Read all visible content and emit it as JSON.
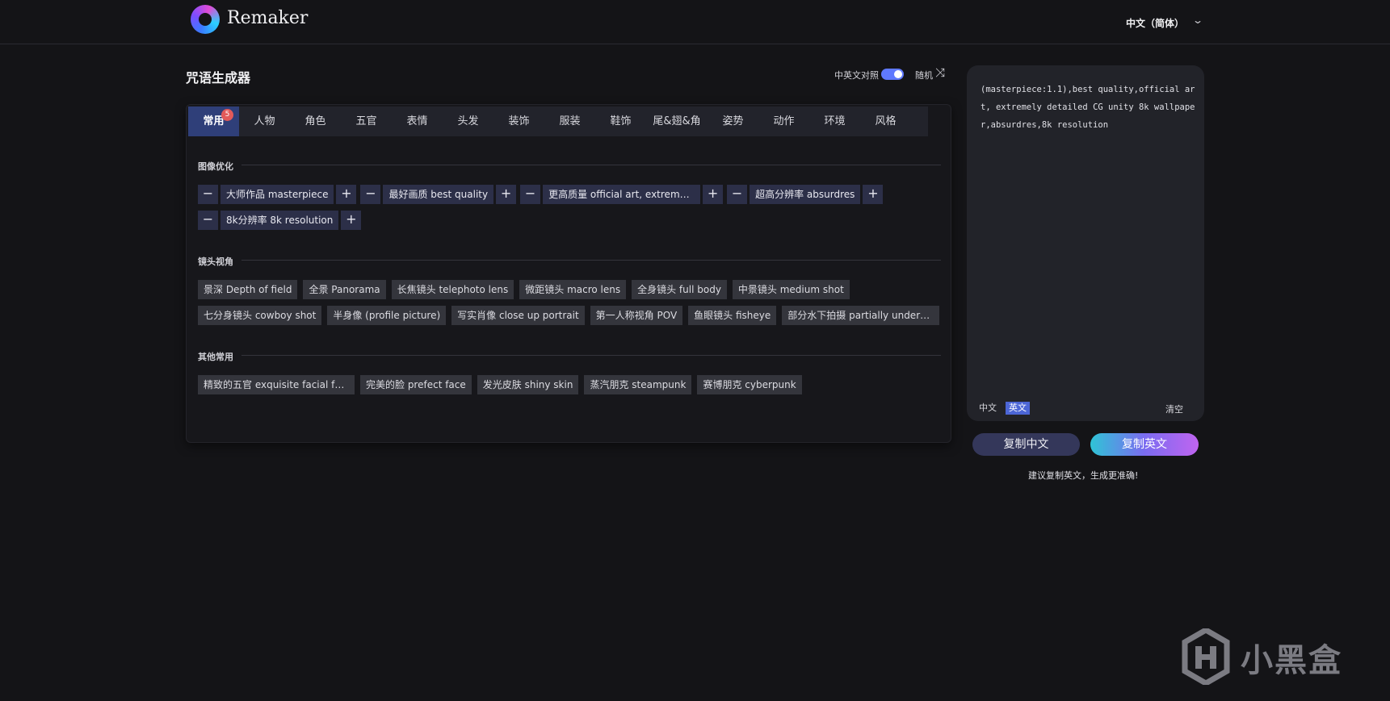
{
  "header": {
    "brand": "Remaker",
    "language": "中文（简体）"
  },
  "toolbar": {
    "title": "咒语生成器",
    "bilingual_label": "中英文对照",
    "bilingual_on": true,
    "random_label": "随机"
  },
  "tabs": [
    {
      "label": "常用",
      "badge": "5",
      "active": true
    },
    {
      "label": "人物"
    },
    {
      "label": "角色"
    },
    {
      "label": "五官"
    },
    {
      "label": "表情"
    },
    {
      "label": "头发"
    },
    {
      "label": "装饰"
    },
    {
      "label": "服装"
    },
    {
      "label": "鞋饰"
    },
    {
      "label": "尾&翅&角"
    },
    {
      "label": "姿势"
    },
    {
      "label": "动作"
    },
    {
      "label": "环境"
    },
    {
      "label": "风格"
    }
  ],
  "sections": {
    "image_opt": {
      "title": "图像优化",
      "selected": [
        "大师作品 masterpiece",
        "最好画质 best quality",
        "更高质量 official art, extremel…",
        "超高分辨率 absurdres",
        "8k分辨率 8k resolution"
      ]
    },
    "lens": {
      "title": "镜头视角",
      "row1": [
        "景深 Depth of field",
        "全景 Panorama",
        "长焦镜头 telephoto lens",
        "微距镜头 macro lens",
        "全身镜头 full body",
        "中景镜头 medium shot"
      ],
      "row2": [
        "七分身镜头 cowboy shot",
        "半身像 (profile picture)",
        "写实肖像 close up portrait",
        "第一人称视角 POV",
        "鱼眼镜头 fisheye",
        "部分水下拍摄 partially underw…"
      ]
    },
    "other": {
      "title": "其他常用",
      "row1": [
        "精致的五官 exquisite facial fe…",
        "完美的脸 prefect face",
        "发光皮肤 shiny skin",
        "蒸汽朋克 steampunk",
        "赛博朋克 cyberpunk"
      ]
    }
  },
  "output": {
    "text": "(masterpiece:1.1),best quality,official art, extremely detailed CG unity 8k wallpaper,absurdres,8k resolution",
    "lang_zh": "中文",
    "lang_en": "英文",
    "clear_label": "清空"
  },
  "actions": {
    "copy_zh": "复制中文",
    "copy_en": "复制英文",
    "hint": "建议复制英文，生成更准确!"
  },
  "watermark": "小黑盒",
  "colors": {
    "accent": "#5f79ff",
    "tab_active": "#2f3f79",
    "chip_selected": "#2c2f48",
    "background": "#141417"
  }
}
